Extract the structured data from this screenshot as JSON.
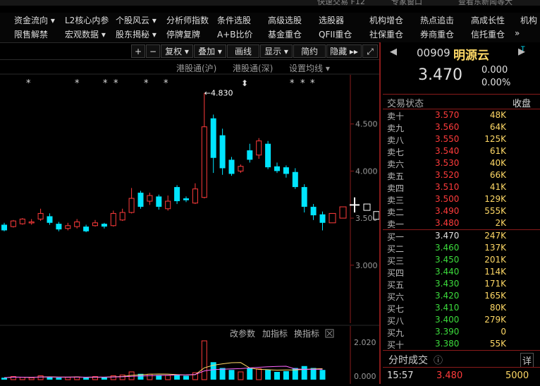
{
  "top_strip": [
    "快速交易 F12",
    "专家窗口",
    "查看东新闻等大"
  ],
  "menu_row1": [
    "资金流向 ▾",
    "L2核心内参",
    "个股风云 ▾",
    "分析师指数",
    "条件选股",
    "高级选股",
    "选股器",
    "机构增仓",
    "热点追击",
    "高成长性",
    "机构"
  ],
  "menu_row2": [
    "限售解禁",
    "宏观数据 ▾",
    "股东揭秘 ▾",
    "停牌复牌",
    "A+B比价",
    "基金重仓",
    "QFII重仓",
    "社保重仓",
    "券商重仓",
    "信托重仓",
    "»"
  ],
  "toolbar": [
    "+",
    "−",
    "复权 ▾",
    "叠加 ▾",
    "画线",
    "显示 ▾",
    "简约",
    "隐藏 ▸▸",
    "⤢"
  ],
  "chart_header": {
    "hk_sh": "港股通(沪)",
    "hk_sz": "港股通(深)",
    "ma_setting": "设置均线 ▾"
  },
  "chart_data": {
    "type": "candlestick",
    "y_ticks": [
      "4.500",
      "4.000",
      "3.500",
      "3.000"
    ],
    "high_label": "←4.830",
    "candles": [
      {
        "o": 3.43,
        "c": 3.37,
        "h": 3.45,
        "l": 3.36
      },
      {
        "o": 3.41,
        "c": 3.47,
        "h": 3.48,
        "l": 3.4
      },
      {
        "o": 3.44,
        "c": 3.49,
        "h": 3.5,
        "l": 3.43
      },
      {
        "o": 3.45,
        "c": 3.46,
        "h": 3.49,
        "l": 3.43
      },
      {
        "o": 3.49,
        "c": 3.55,
        "h": 3.6,
        "l": 3.47
      },
      {
        "o": 3.52,
        "c": 3.45,
        "h": 3.55,
        "l": 3.43
      },
      {
        "o": 3.44,
        "c": 3.38,
        "h": 3.46,
        "l": 3.36
      },
      {
        "o": 3.39,
        "c": 3.42,
        "h": 3.45,
        "l": 3.37
      },
      {
        "o": 3.41,
        "c": 3.46,
        "h": 3.49,
        "l": 3.39
      },
      {
        "o": 3.41,
        "c": 3.36,
        "h": 3.43,
        "l": 3.35
      },
      {
        "o": 3.42,
        "c": 3.45,
        "h": 3.48,
        "l": 3.41
      },
      {
        "o": 3.44,
        "c": 3.41,
        "h": 3.45,
        "l": 3.39
      },
      {
        "o": 3.42,
        "c": 3.55,
        "h": 3.58,
        "l": 3.41
      },
      {
        "o": 3.48,
        "c": 3.56,
        "h": 3.6,
        "l": 3.47
      },
      {
        "o": 3.56,
        "c": 3.71,
        "h": 3.82,
        "l": 3.55
      },
      {
        "o": 3.77,
        "c": 3.62,
        "h": 3.79,
        "l": 3.6
      },
      {
        "o": 3.68,
        "c": 3.74,
        "h": 3.77,
        "l": 3.64
      },
      {
        "o": 3.73,
        "c": 3.62,
        "h": 3.75,
        "l": 3.59
      },
      {
        "o": 3.6,
        "c": 3.68,
        "h": 3.74,
        "l": 3.58
      },
      {
        "o": 3.83,
        "c": 3.68,
        "h": 3.85,
        "l": 3.65
      },
      {
        "o": 3.71,
        "c": 3.69,
        "h": 3.73,
        "l": 3.67
      },
      {
        "o": 3.66,
        "c": 3.81,
        "h": 3.87,
        "l": 3.65
      },
      {
        "o": 3.72,
        "c": 4.47,
        "h": 4.83,
        "l": 3.71
      },
      {
        "o": 4.56,
        "c": 4.14,
        "h": 4.6,
        "l": 3.98
      },
      {
        "o": 4.38,
        "c": 4.03,
        "h": 4.45,
        "l": 3.96
      },
      {
        "o": 4.12,
        "c": 3.97,
        "h": 4.15,
        "l": 3.95
      },
      {
        "o": 4.0,
        "c": 4.05,
        "h": 4.07,
        "l": 3.98
      },
      {
        "o": 4.22,
        "c": 4.12,
        "h": 4.29,
        "l": 4.09
      },
      {
        "o": 4.17,
        "c": 4.32,
        "h": 4.35,
        "l": 4.13
      },
      {
        "o": 4.29,
        "c": 4.04,
        "h": 4.32,
        "l": 4.02
      },
      {
        "o": 4.05,
        "c": 4.0,
        "h": 4.09,
        "l": 3.98
      },
      {
        "o": 4.04,
        "c": 3.97,
        "h": 4.06,
        "l": 3.93
      },
      {
        "o": 3.99,
        "c": 3.83,
        "h": 4.03,
        "l": 3.81
      },
      {
        "o": 3.83,
        "c": 3.62,
        "h": 3.86,
        "l": 3.56
      },
      {
        "o": 3.62,
        "c": 3.53,
        "h": 3.65,
        "l": 3.48
      },
      {
        "o": 3.54,
        "c": 3.45,
        "h": 3.57,
        "l": 3.37
      }
    ],
    "last_open": 3.47,
    "last_close": 3.48
  },
  "subchart": {
    "buttons": [
      "改参数",
      "加指标",
      "换指标"
    ],
    "y_ticks": [
      "2.020",
      "0.000"
    ]
  },
  "quote": {
    "code": "00909",
    "name": "明源云",
    "price": "3.470",
    "change": "0.000",
    "change_pct": "0.00%"
  },
  "orderbook_header": {
    "title": "交易状态",
    "status": "收盘"
  },
  "asks": [
    {
      "label": "卖十",
      "price": "3.570",
      "vol": "48K"
    },
    {
      "label": "卖九",
      "price": "3.560",
      "vol": "64K"
    },
    {
      "label": "卖八",
      "price": "3.550",
      "vol": "125K"
    },
    {
      "label": "卖七",
      "price": "3.540",
      "vol": "61K"
    },
    {
      "label": "卖六",
      "price": "3.530",
      "vol": "40K"
    },
    {
      "label": "卖五",
      "price": "3.520",
      "vol": "66K"
    },
    {
      "label": "卖四",
      "price": "3.510",
      "vol": "41K"
    },
    {
      "label": "卖三",
      "price": "3.500",
      "vol": "129K"
    },
    {
      "label": "卖二",
      "price": "3.490",
      "vol": "555K"
    },
    {
      "label": "卖一",
      "price": "3.480",
      "vol": "2K"
    }
  ],
  "bids": [
    {
      "label": "买一",
      "price": "3.470",
      "vol": "247K"
    },
    {
      "label": "买二",
      "price": "3.460",
      "vol": "137K"
    },
    {
      "label": "买三",
      "price": "3.450",
      "vol": "201K"
    },
    {
      "label": "买四",
      "price": "3.440",
      "vol": "114K"
    },
    {
      "label": "买五",
      "price": "3.430",
      "vol": "171K"
    },
    {
      "label": "买六",
      "price": "3.420",
      "vol": "165K"
    },
    {
      "label": "买七",
      "price": "3.410",
      "vol": "80K"
    },
    {
      "label": "买八",
      "price": "3.400",
      "vol": "279K"
    },
    {
      "label": "买九",
      "price": "3.390",
      "vol": "0"
    },
    {
      "label": "买十",
      "price": "3.380",
      "vol": "55K"
    }
  ],
  "trades": {
    "title": "分时成交",
    "detail": "详",
    "time": "15:57",
    "price": "3.480",
    "vol": "5000"
  },
  "colors": {
    "up": "#ff3b3b",
    "down": "#00e5ff",
    "accent": "#ffd966"
  }
}
